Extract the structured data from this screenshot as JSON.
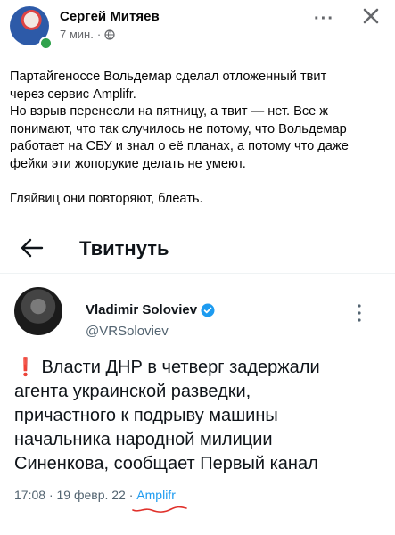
{
  "post": {
    "author_name": "Сергей Митяев",
    "time": "7 мин.",
    "separator": "·",
    "more_label": "···",
    "lines": [
      "Партайгеноссе Вольдемар сделал отложенный твит",
      "через сервис Amplifr.",
      "Но взрыв перенесли на пятницу, а твит — нет. Все ж",
      "понимают, что так случилось не потому, что Вольдемар",
      "работает на СБУ и знал о её  планах, а потому что даже",
      "фейки эти жопорукие  делать не умеют."
    ],
    "closing": "Гляйвиц  они повторяют, блеать."
  },
  "tweet_page": {
    "title": "Твитнуть"
  },
  "tweet": {
    "name": "Vladimir Soloviev",
    "handle": "@VRSoloviev",
    "alert_glyph": "❗",
    "lines": [
      "Власти ДНР в четверг задержали",
      "агента украинской разведки,",
      "причастного к подрыву машины",
      "начальника народной милиции",
      "Синенкова, сообщает Первый канал"
    ],
    "time": "17:08",
    "date": "19 февр. 22",
    "separator": "·",
    "source": "Amplifr"
  },
  "colors": {
    "online": "#31a24c",
    "verified": "#1d9bf0",
    "alert": "#e0245e",
    "annotation": "#e0302a"
  }
}
